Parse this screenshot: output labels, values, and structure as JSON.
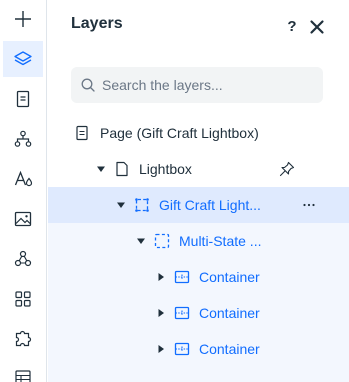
{
  "toolbar": {
    "items": [
      {
        "name": "add-elements",
        "icon": "plus-icon"
      },
      {
        "name": "layers",
        "icon": "layers-icon",
        "active": true
      },
      {
        "name": "pages",
        "icon": "page-icon"
      },
      {
        "name": "site-structure",
        "icon": "sitemap-icon"
      },
      {
        "name": "design",
        "icon": "text-style-icon"
      },
      {
        "name": "media",
        "icon": "image-icon"
      },
      {
        "name": "apps",
        "icon": "apps-icon"
      },
      {
        "name": "app-market",
        "icon": "grid-icon"
      },
      {
        "name": "add-ons",
        "icon": "puzzle-icon"
      },
      {
        "name": "cms",
        "icon": "table-icon"
      }
    ]
  },
  "panel": {
    "title": "Layers",
    "help_label": "?",
    "search_placeholder": "Search the layers..."
  },
  "layers": [
    {
      "label": "Page (Gift Craft Lightbox)",
      "icon": "page-icon",
      "state": "none"
    },
    {
      "label": "Lightbox",
      "icon": "lightbox-icon",
      "state": "expanded",
      "pin_icon": "pin-icon"
    },
    {
      "label": "Gift Craft Light...",
      "icon": "dashed-frame-icon",
      "state": "expanded",
      "selected": true,
      "more_icon": "more-icon"
    },
    {
      "label": "Multi-State ...",
      "icon": "multistate-icon",
      "state": "expanded"
    },
    {
      "label": "Container",
      "icon": "container-icon",
      "state": "collapsed"
    },
    {
      "label": "Container",
      "icon": "container-icon",
      "state": "collapsed"
    },
    {
      "label": "Container",
      "icon": "container-icon",
      "state": "collapsed"
    }
  ],
  "colors": {
    "accent": "#116dff",
    "selected_row": "#dfeafe",
    "child_row": "#f3f7fe",
    "text": "#20303c"
  }
}
